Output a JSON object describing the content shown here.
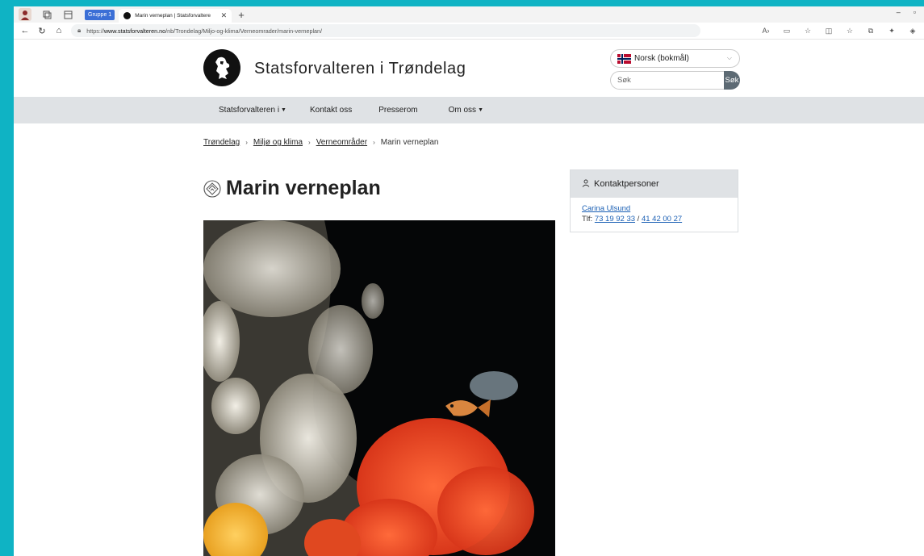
{
  "browser": {
    "group_label": "Gruppe 1",
    "tab_title": "Marin verneplan | Statsforvaltere",
    "url_prefix": "https://",
    "url_host": "www.statsforvalteren.no",
    "url_path": "/nb/Trondelag/Miljo-og-klima/Verneomrader/marin-verneplan/",
    "icons": [
      "back-icon",
      "reload-icon",
      "home-icon",
      "lock-icon",
      "read-aloud-icon",
      "favorites-icon",
      "split-screen-icon",
      "collections-icon",
      "extensions-icon"
    ]
  },
  "header": {
    "site_title": "Statsforvalteren i Trøndelag",
    "language": "Norsk (bokmål)",
    "search_placeholder": "Søk",
    "search_button": "Søk"
  },
  "nav": {
    "items": [
      {
        "label": "Statsforvalteren i",
        "has_menu": true
      },
      {
        "label": "Kontakt oss",
        "has_menu": false
      },
      {
        "label": "Presserom",
        "has_menu": false
      },
      {
        "label": "Om oss",
        "has_menu": true
      }
    ]
  },
  "breadcrumb": {
    "items": [
      "Trøndelag",
      "Miljø og klima",
      "Verneområder"
    ],
    "current": "Marin verneplan",
    "separator": "›"
  },
  "main": {
    "title": "Marin verneplan"
  },
  "contact": {
    "heading": "Kontaktpersoner",
    "name": "Carina Ulsund",
    "phone_prefix": "Tlf: ",
    "phone_1": "73 19 92 33",
    "phone_sep": " / ",
    "phone_2": "41 42 00 27"
  },
  "colors": {
    "page_bg": "#0fb3c4",
    "nav_bg": "#dfe2e5",
    "link": "#1a5fb4",
    "search_button": "#5d6a74"
  }
}
